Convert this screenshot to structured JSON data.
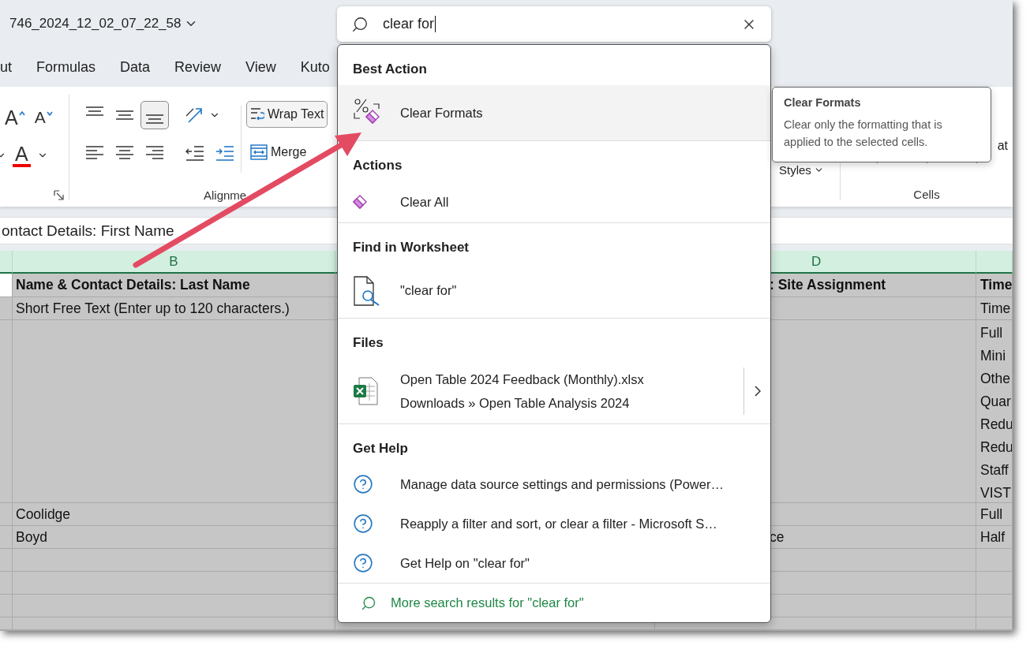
{
  "window": {
    "title": "746_2024_12_02_07_22_58"
  },
  "ribbon_tabs": [
    "ut",
    "Formulas",
    "Data",
    "Review",
    "View",
    "Kuto"
  ],
  "ribbon": {
    "font_buttons": [
      {
        "label": "A",
        "kind": "grow"
      },
      {
        "label": "A",
        "kind": "shrink"
      },
      {
        "label": "A",
        "kind": "font_color"
      }
    ],
    "vertical_align": [
      {
        "kind": "top",
        "selected": false
      },
      {
        "kind": "middle",
        "selected": false
      },
      {
        "kind": "bottom",
        "selected": true
      }
    ],
    "wrap_text": "Wrap Text",
    "merge": "Merge",
    "alignment_label": "Alignme",
    "styles": "Styles",
    "cells_label": "Cells",
    "format_partial": "at"
  },
  "formula_bar": {
    "value": "ontact Details: First Name"
  },
  "column_headers": {
    "b": "B",
    "d": "D"
  },
  "rows": [
    {
      "kind": "header",
      "column_b": "Name & Contact Details: Last Name",
      "column_d": ": Site Assignment",
      "column_e": [
        "Time"
      ]
    },
    {
      "kind": "data",
      "column_b": "Short Free Text (Enter up to 120 characters.)",
      "column_e": [
        "Time"
      ]
    },
    {
      "kind": "tall",
      "column_e": [
        "Full",
        "Mini",
        "Othe",
        "Quar",
        "Redu",
        "Redu",
        "Staff",
        "VIST"
      ]
    },
    {
      "kind": "data",
      "column_b": "Coolidge",
      "column_e": [
        "Full"
      ]
    },
    {
      "kind": "data",
      "column_b": "Boyd",
      "column_d": "ce",
      "column_e": [
        "Half"
      ]
    }
  ],
  "search": {
    "value": "clear for"
  },
  "results": [
    {
      "heading": "Best Action",
      "items": [
        {
          "kind": "clear_formats",
          "label": "Clear Formats",
          "selected": true
        }
      ]
    },
    {
      "heading": "Actions",
      "items": [
        {
          "kind": "clear_all",
          "label": "Clear All",
          "selected": false
        }
      ]
    },
    {
      "heading": "Find in Worksheet",
      "items": [
        {
          "kind": "find",
          "label": "\"clear for\"",
          "selected": false
        }
      ]
    },
    {
      "heading": "Files",
      "items": [
        {
          "kind": "file",
          "label": "Open Table 2024 Feedback (Monthly).xlsx",
          "path": "Downloads » Open Table Analysis 2024",
          "selected": false
        }
      ]
    },
    {
      "heading": "Get Help",
      "items": [
        {
          "kind": "help",
          "label": "Manage data source settings and permissions (Power…",
          "selected": false
        },
        {
          "kind": "help",
          "label": "Reapply a filter and sort, or clear a filter - Microsoft S…",
          "selected": false
        },
        {
          "kind": "help",
          "label": "Get Help on \"clear for\"",
          "selected": false
        }
      ]
    }
  ],
  "more_results": "More search results for \"clear for\"",
  "tooltip": {
    "title": "Clear Formats",
    "description": "Clear only the formatting that is applied to the selected cells."
  }
}
